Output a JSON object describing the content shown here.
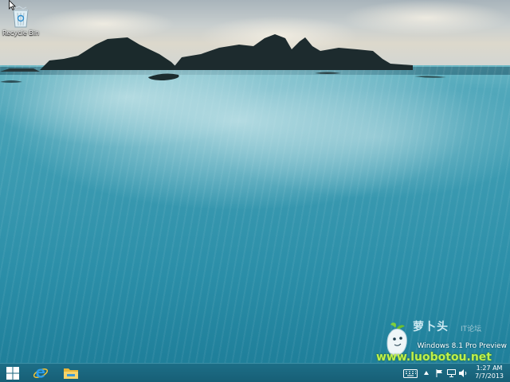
{
  "desktop": {
    "recycle_bin_label": "Recycle Bin"
  },
  "watermark": {
    "brand": "萝卜头",
    "brand_sub": "IT论坛",
    "site": "www.luobotou.net"
  },
  "edition_text": "Windows 8.1 Pro Preview",
  "taskbar": {
    "pinned": [
      "start-button",
      "internet-explorer",
      "file-explorer"
    ],
    "tray_icons": [
      "keyboard-icon",
      "show-hidden-icons",
      "flag-icon",
      "network-icon",
      "volume-icon"
    ],
    "clock_time": "1:27 AM",
    "clock_date": "7/7/2013"
  },
  "colors": {
    "taskbar": "#175f76",
    "accent_blue": "#1e90e0",
    "folder_yellow": "#f3c64a"
  }
}
